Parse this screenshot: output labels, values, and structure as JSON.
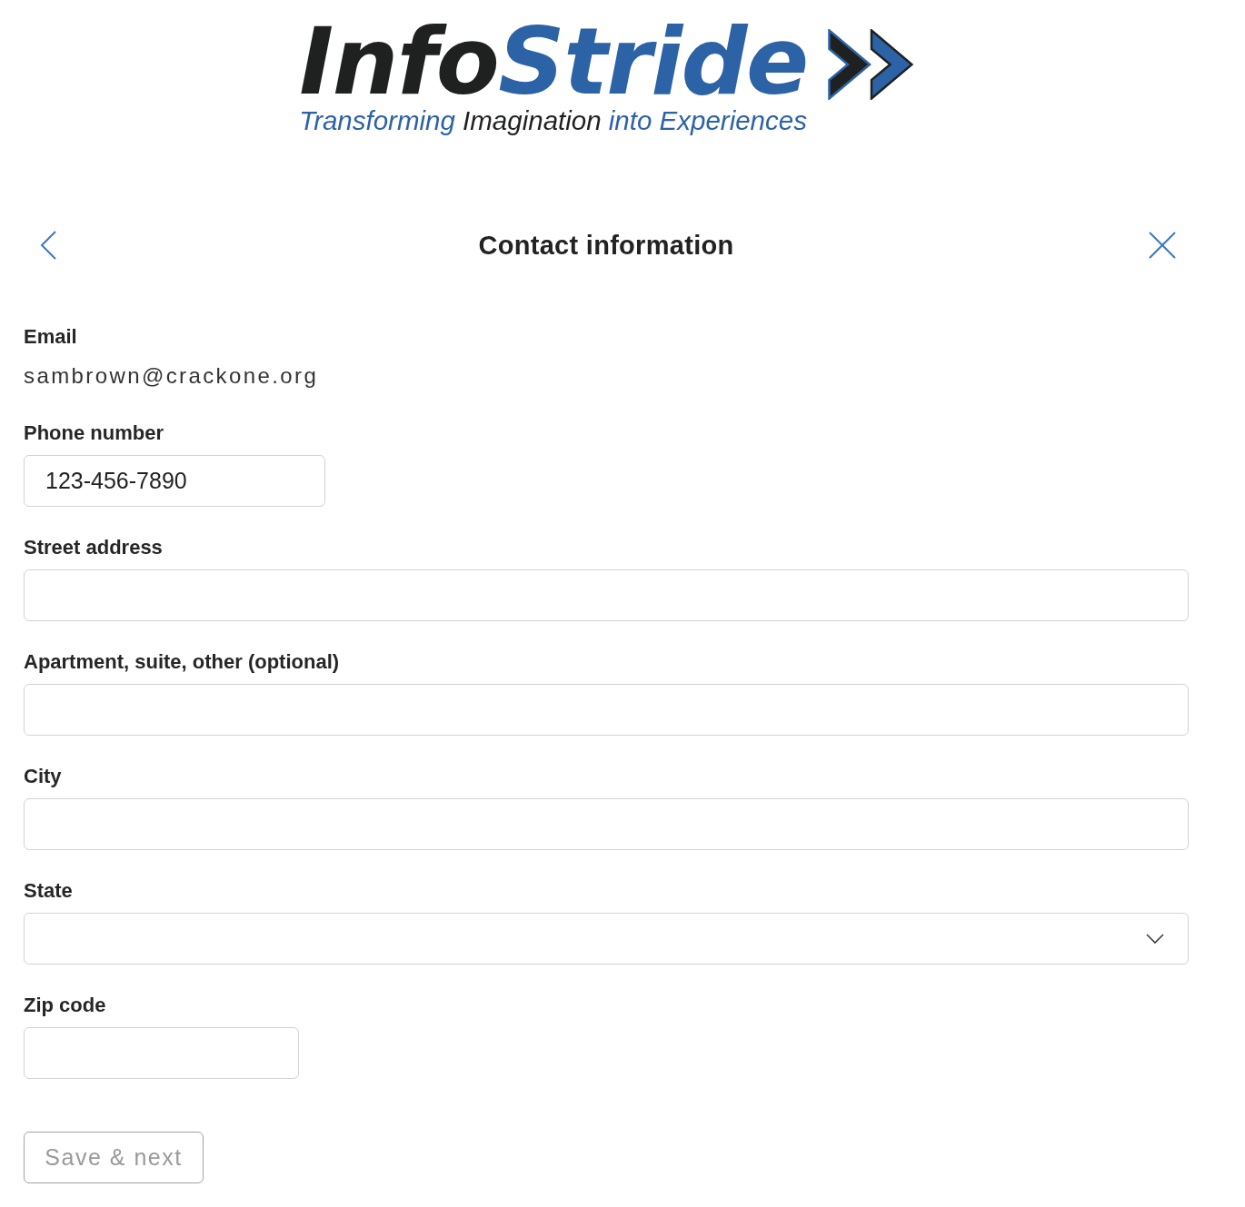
{
  "logo": {
    "wordmark": [
      {
        "text": "Info",
        "color": "#1f2120"
      },
      {
        "text": "Stride",
        "color": "#2c62a6"
      }
    ],
    "tagline": [
      {
        "text": "Transforming",
        "color": "#2c62a6"
      },
      {
        "text": "Imagination",
        "color": "#1f2120"
      },
      {
        "text": "into Experiences",
        "color": "#2c62a6"
      }
    ]
  },
  "header": {
    "title": "Contact information"
  },
  "fields": [
    {
      "kind": "display",
      "label": "Email",
      "value": "sambrown@crackone.org"
    },
    {
      "kind": "phone",
      "label": "Phone number",
      "value": "123-456-7890"
    },
    {
      "kind": "text",
      "label": "Street address"
    },
    {
      "kind": "text",
      "label": "Apartment, suite, other (optional)"
    },
    {
      "kind": "text",
      "label": "City"
    },
    {
      "kind": "select",
      "label": "State"
    },
    {
      "kind": "zip",
      "label": "Zip code"
    }
  ],
  "submit_button": {
    "label": "Save & next",
    "disabled": true
  }
}
